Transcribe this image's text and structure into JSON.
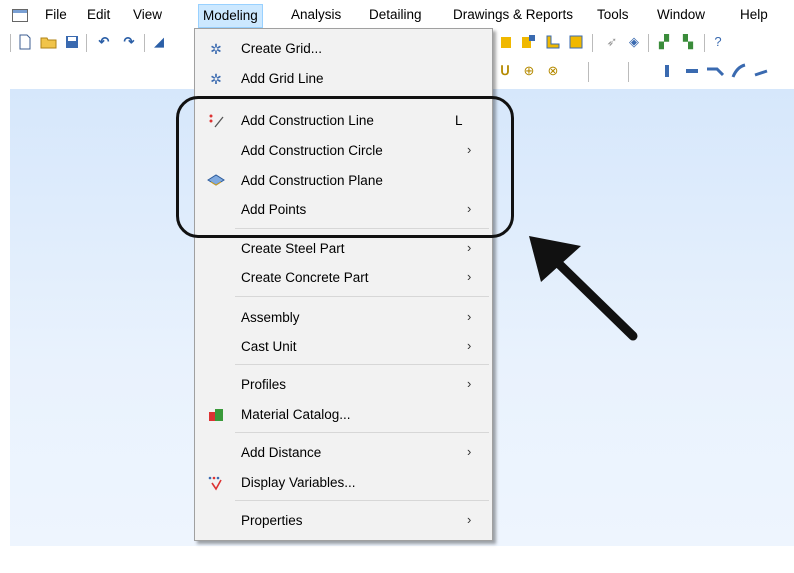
{
  "menubar": {
    "items": [
      "File",
      "Edit",
      "View",
      "Modeling",
      "Analysis",
      "Detailing",
      "Drawings & Reports",
      "Tools",
      "Window",
      "Help"
    ]
  },
  "menu": {
    "items": [
      {
        "label": "Create Grid...",
        "icon": "grid-icon"
      },
      {
        "label": "Add Grid Line",
        "icon": "grid-line-icon"
      },
      {
        "label": "Add Construction Line",
        "icon": "construction-line-icon",
        "shortcut": "L"
      },
      {
        "label": "Add Construction Circle",
        "submenu": true
      },
      {
        "label": "Add Construction Plane",
        "icon": "construction-plane-icon"
      },
      {
        "label": "Add Points",
        "submenu": true
      },
      {
        "label": "Create Steel Part",
        "submenu": true
      },
      {
        "label": "Create Concrete Part",
        "submenu": true
      },
      {
        "label": "Assembly",
        "submenu": true
      },
      {
        "label": "Cast Unit",
        "submenu": true
      },
      {
        "label": "Profiles",
        "submenu": true
      },
      {
        "label": "Material Catalog...",
        "icon": "material-catalog-icon"
      },
      {
        "label": "Add Distance",
        "submenu": true
      },
      {
        "label": "Display Variables...",
        "icon": "display-variables-icon"
      },
      {
        "label": "Properties",
        "submenu": true
      }
    ],
    "arrow_glyph": "›"
  },
  "colors": {
    "menu_active_bg": "#cce8ff",
    "workspace": "#dde9fb",
    "annotation": "#111111"
  }
}
